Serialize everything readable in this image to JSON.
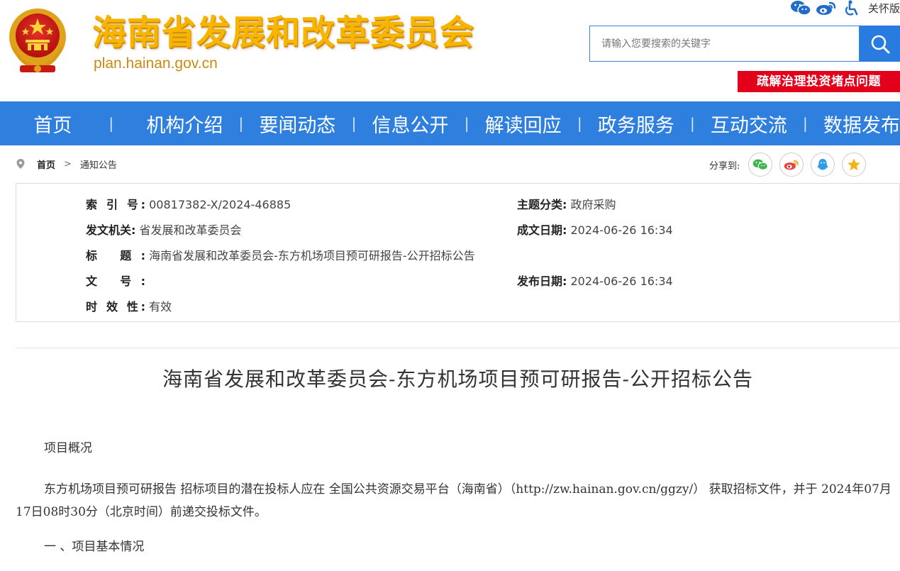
{
  "header": {
    "site_title": "海南省发展和改革委员会",
    "site_domain": "plan.hainan.gov.cn",
    "care_mode_label": "关怀版",
    "search_placeholder": "请输入您要搜索的关键字",
    "promo_banner": "疏解治理投资堵点问题",
    "tool_icons": [
      "wechat-icon",
      "weibo-icon",
      "accessibility-icon"
    ]
  },
  "nav": {
    "items": [
      "首页",
      "机构介绍",
      "要闻动态",
      "信息公开",
      "解读回应",
      "政务服务",
      "互动交流",
      "数据发布"
    ],
    "separator": "|"
  },
  "breadcrumb": {
    "home": "首页",
    "arrow": ">",
    "current": "通知公告"
  },
  "share": {
    "label": "分享到:",
    "icons": [
      "wechat-icon",
      "weibo-icon",
      "qq-icon",
      "qzone-icon"
    ]
  },
  "info": {
    "index_label": "索 引 号:",
    "index_value": "00817382-X/2024-46885",
    "category_label": "主题分类:",
    "category_value": "政府采购",
    "issuer_label": "发文机关:",
    "issuer_value": "省发展和改革委员会",
    "created_label": "成文日期:",
    "created_value": "2024-06-26 16:34",
    "title_label": "标 题:",
    "title_value": "海南省发展和改革委员会-东方机场项目预可研报告-公开招标公告",
    "docno_label": "文 号:",
    "docno_value": "",
    "published_label": "发布日期:",
    "published_value": "2024-06-26 16:34",
    "validity_label": "时 效 性:",
    "validity_value": "有效"
  },
  "article": {
    "title": "海南省发展和改革委员会-东方机场项目预可研报告-公开招标公告",
    "section_overview": "项目概况",
    "overview_text": "东方机场项目预可研报告  招标项目的潜在投标人应在  全国公共资源交易平台（海南省）（http://zw.hainan.gov.cn/ggzy/）  获取招标文件，并于  2024年07月17日08时30分（北京时间）前递交投标文件。",
    "section_one": "一 、项目基本情况"
  },
  "colors": {
    "nav_bg": "#2f7fdf",
    "title_gold": "#f7b500",
    "banner_red": "#e3001b"
  }
}
